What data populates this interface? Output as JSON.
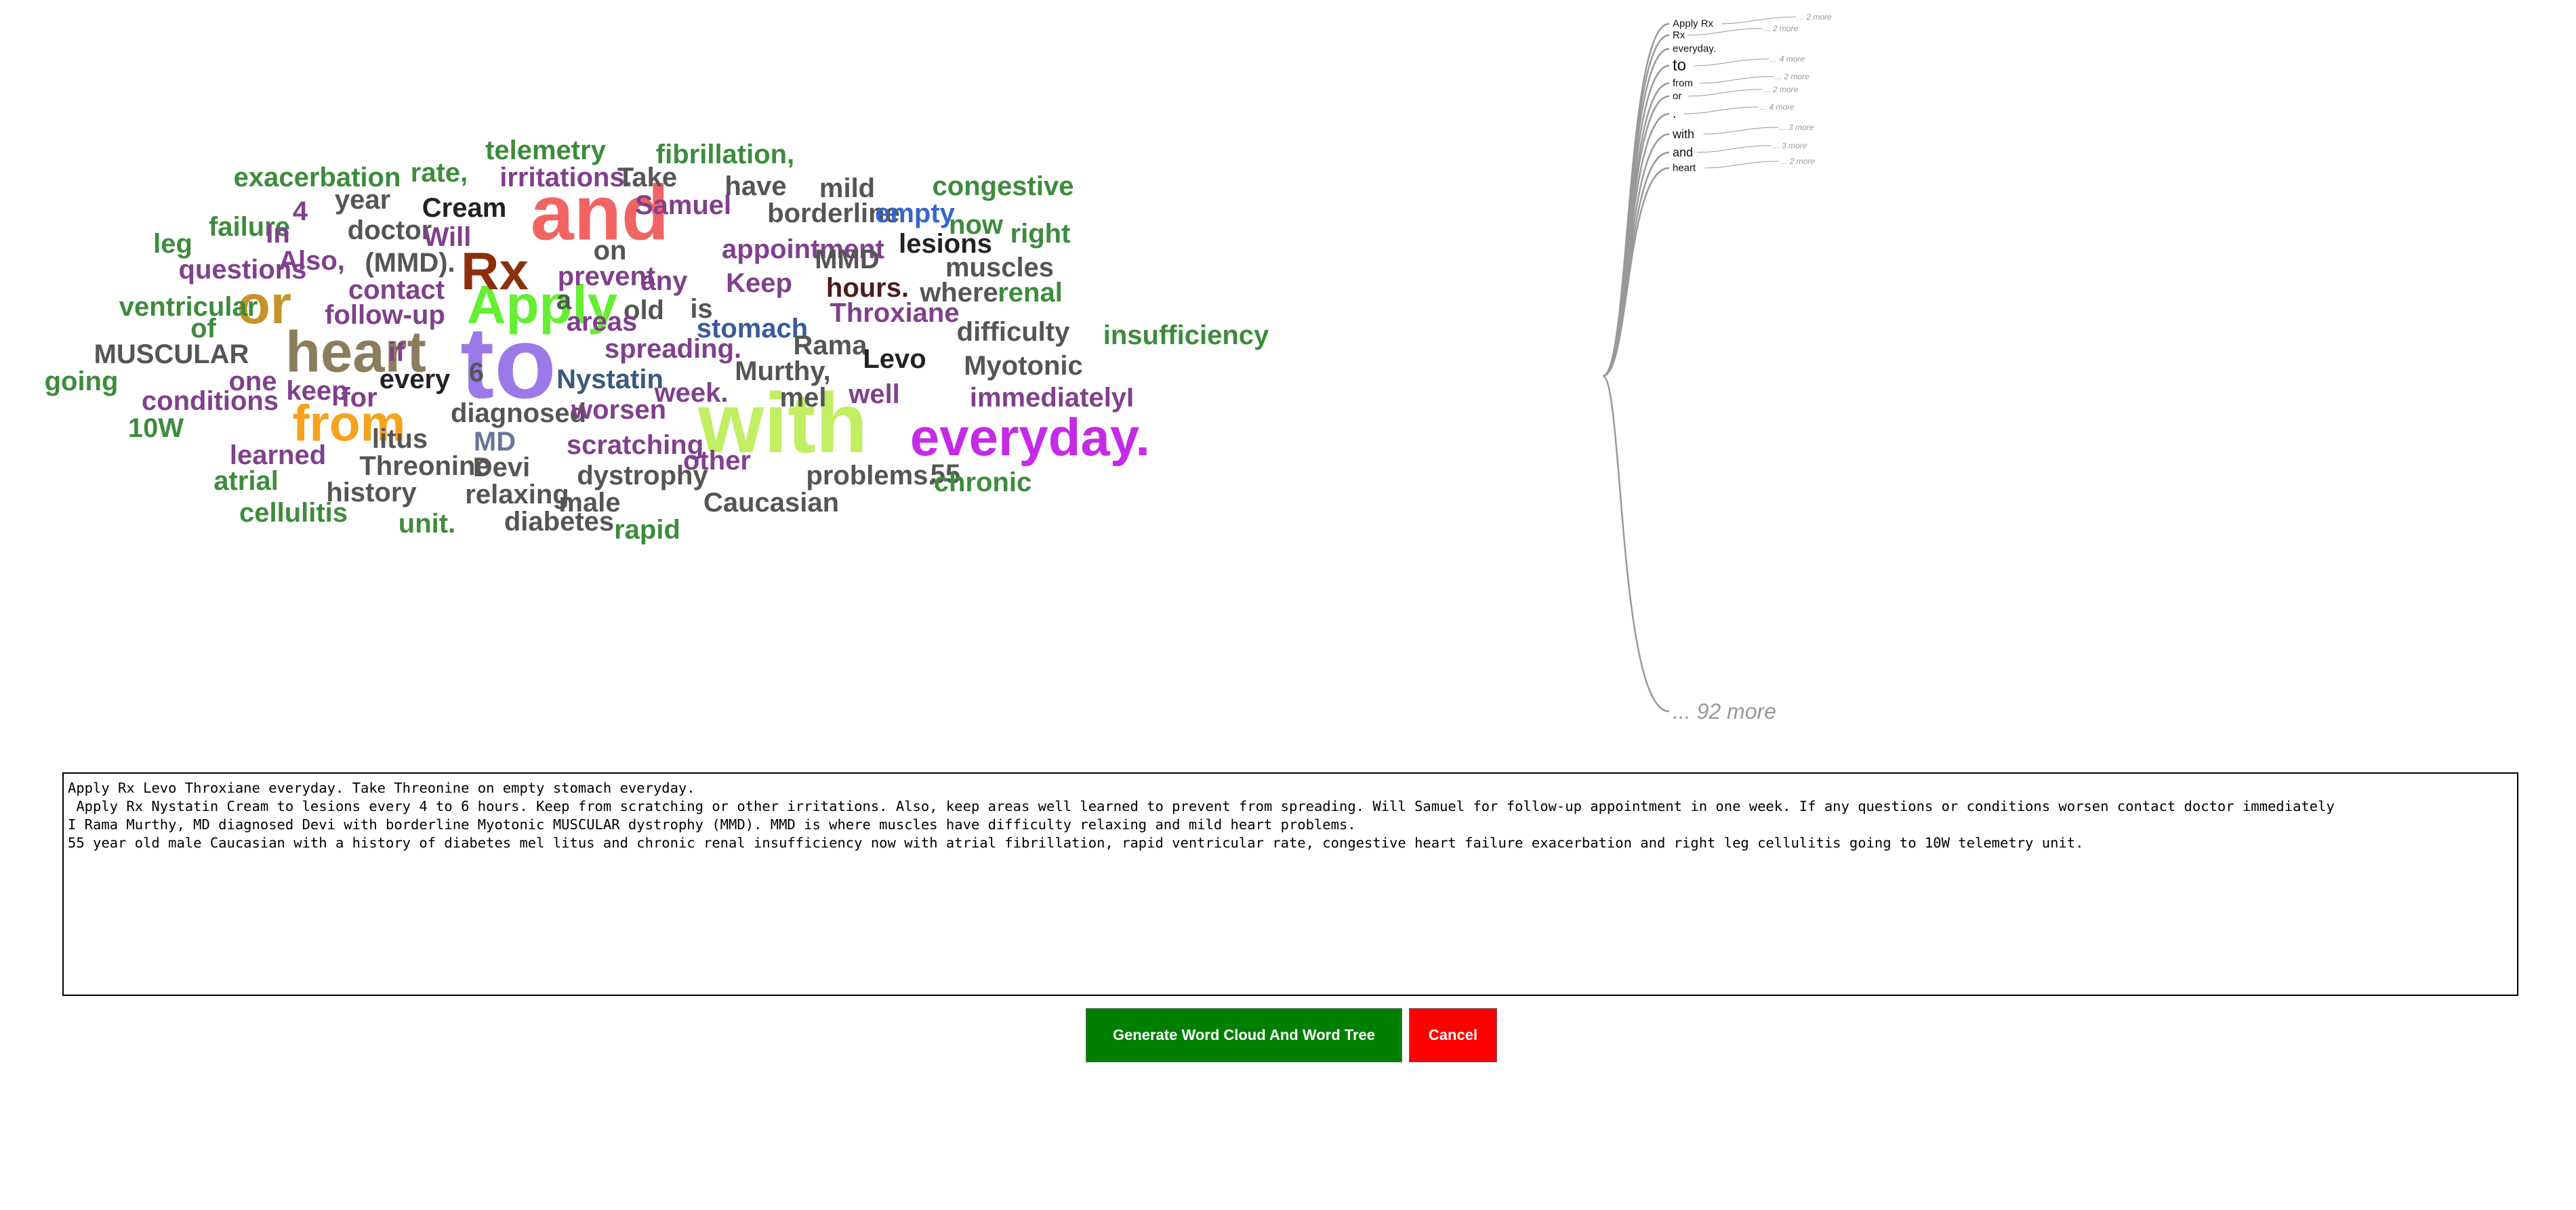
{
  "cloud": {
    "words": [
      {
        "text": "to",
        "color": "#9b79e9",
        "size": 150
      },
      {
        "text": "with",
        "color": "#c2ee63",
        "size": 125
      },
      {
        "text": "and",
        "color": "#f26464",
        "size": 115
      },
      {
        "text": "heart",
        "color": "#8b7d5d",
        "size": 85
      },
      {
        "text": "from",
        "color": "#f5a21d",
        "size": 75
      },
      {
        "text": "everyday.",
        "color": "#c32be6",
        "size": 78
      },
      {
        "text": "Apply",
        "color": "#66ee33",
        "size": 80
      },
      {
        "text": "Rx",
        "color": "#8b2f0c",
        "size": 78
      },
      {
        "text": "or",
        "color": "#c4932a",
        "size": 80
      },
      {
        "text": "telemetry",
        "color": "#3c8c3c",
        "size": 40
      },
      {
        "text": "fibrillation,",
        "color": "#3c8c3c",
        "size": 40
      },
      {
        "text": "exacerbation",
        "color": "#3c8c3c",
        "size": 40
      },
      {
        "text": "rate,",
        "color": "#3c8c3c",
        "size": 40
      },
      {
        "text": "irritations.",
        "color": "#80408c",
        "size": 40
      },
      {
        "text": "Take",
        "color": "#555555",
        "size": 40
      },
      {
        "text": "have",
        "color": "#555555",
        "size": 40
      },
      {
        "text": "mild",
        "color": "#555555",
        "size": 40
      },
      {
        "text": "congestive",
        "color": "#3c8c3c",
        "size": 40
      },
      {
        "text": "4",
        "color": "#80408c",
        "size": 40
      },
      {
        "text": "year",
        "color": "#555555",
        "size": 40
      },
      {
        "text": "Cream",
        "color": "#222222",
        "size": 40
      },
      {
        "text": "Samuel",
        "color": "#80408c",
        "size": 40
      },
      {
        "text": "borderline",
        "color": "#555555",
        "size": 40
      },
      {
        "text": "empty",
        "color": "#3366cc",
        "size": 40
      },
      {
        "text": "now",
        "color": "#3c8c3c",
        "size": 40
      },
      {
        "text": "right",
        "color": "#3c8c3c",
        "size": 40
      },
      {
        "text": "failure",
        "color": "#3c8c3c",
        "size": 40
      },
      {
        "text": "In",
        "color": "#80408c",
        "size": 40
      },
      {
        "text": "doctor",
        "color": "#555555",
        "size": 40
      },
      {
        "text": "Will",
        "color": "#80408c",
        "size": 40
      },
      {
        "text": "leg",
        "color": "#3c8c3c",
        "size": 40
      },
      {
        "text": "on",
        "color": "#555555",
        "size": 40
      },
      {
        "text": "appointment",
        "color": "#80408c",
        "size": 40
      },
      {
        "text": "MMD",
        "color": "#555555",
        "size": 40
      },
      {
        "text": "lesions",
        "color": "#222222",
        "size": 40
      },
      {
        "text": "questions",
        "color": "#80408c",
        "size": 40
      },
      {
        "text": "Also,",
        "color": "#80408c",
        "size": 40
      },
      {
        "text": "(MMD).",
        "color": "#555555",
        "size": 40
      },
      {
        "text": "prevent",
        "color": "#80408c",
        "size": 40
      },
      {
        "text": "muscles",
        "color": "#555555",
        "size": 40
      },
      {
        "text": "Keep",
        "color": "#80408c",
        "size": 40
      },
      {
        "text": "any",
        "color": "#80408c",
        "size": 40
      },
      {
        "text": "hours.",
        "color": "#4c1c1c",
        "size": 40
      },
      {
        "text": "where",
        "color": "#555555",
        "size": 40
      },
      {
        "text": "renal",
        "color": "#3c8c3c",
        "size": 40
      },
      {
        "text": "contact",
        "color": "#80408c",
        "size": 40
      },
      {
        "text": "ventricular",
        "color": "#3c8c3c",
        "size": 40
      },
      {
        "text": "a",
        "color": "#555555",
        "size": 40
      },
      {
        "text": "old",
        "color": "#555555",
        "size": 40
      },
      {
        "text": "is",
        "color": "#555555",
        "size": 40
      },
      {
        "text": "Throxiane",
        "color": "#80408c",
        "size": 40
      },
      {
        "text": "follow-up",
        "color": "#80408c",
        "size": 40
      },
      {
        "text": "areas",
        "color": "#80408c",
        "size": 40
      },
      {
        "text": "stomach",
        "color": "#3a5a9a",
        "size": 40
      },
      {
        "text": "of",
        "color": "#3c8c3c",
        "size": 40
      },
      {
        "text": "difficulty",
        "color": "#555555",
        "size": 40
      },
      {
        "text": "insufficiency",
        "color": "#3c8c3c",
        "size": 40
      },
      {
        "text": "MUSCULAR",
        "color": "#555555",
        "size": 40
      },
      {
        "text": "spreading.",
        "color": "#80408c",
        "size": 40
      },
      {
        "text": "Rama",
        "color": "#555555",
        "size": 40
      },
      {
        "text": "Levo",
        "color": "#222222",
        "size": 40
      },
      {
        "text": "if",
        "color": "#80408c",
        "size": 40
      },
      {
        "text": "Myotonic",
        "color": "#555555",
        "size": 40
      },
      {
        "text": "one",
        "color": "#80408c",
        "size": 40
      },
      {
        "text": "6",
        "color": "#555555",
        "size": 40
      },
      {
        "text": "Murthy,",
        "color": "#555555",
        "size": 40
      },
      {
        "text": "going",
        "color": "#3c8c3c",
        "size": 40
      },
      {
        "text": "every",
        "color": "#222222",
        "size": 40
      },
      {
        "text": "Nystatin",
        "color": "#3a5a7a",
        "size": 40
      },
      {
        "text": "keep",
        "color": "#80408c",
        "size": 40
      },
      {
        "text": "for",
        "color": "#80408c",
        "size": 40
      },
      {
        "text": "week.",
        "color": "#80408c",
        "size": 40
      },
      {
        "text": "mel",
        "color": "#555555",
        "size": 40
      },
      {
        "text": "well",
        "color": "#80408c",
        "size": 40
      },
      {
        "text": "immediatelyI",
        "color": "#80408c",
        "size": 40
      },
      {
        "text": "conditions",
        "color": "#80408c",
        "size": 40
      },
      {
        "text": "diagnosed",
        "color": "#555555",
        "size": 40
      },
      {
        "text": "worsen",
        "color": "#80408c",
        "size": 40
      },
      {
        "text": "10W",
        "color": "#3c8c3c",
        "size": 40
      },
      {
        "text": "litus",
        "color": "#555555",
        "size": 40
      },
      {
        "text": "MD",
        "color": "#667799",
        "size": 40
      },
      {
        "text": "scratching",
        "color": "#80408c",
        "size": 40
      },
      {
        "text": "learned",
        "color": "#80408c",
        "size": 40
      },
      {
        "text": "Threonine",
        "color": "#555555",
        "size": 40
      },
      {
        "text": "Devi",
        "color": "#555555",
        "size": 40
      },
      {
        "text": "other",
        "color": "#80408c",
        "size": 40
      },
      {
        "text": "atrial",
        "color": "#3c8c3c",
        "size": 40
      },
      {
        "text": "dystrophy",
        "color": "#555555",
        "size": 40
      },
      {
        "text": "problems.",
        "color": "#555555",
        "size": 40
      },
      {
        "text": "55",
        "color": "#555555",
        "size": 40
      },
      {
        "text": "chronic",
        "color": "#3c8c3c",
        "size": 40
      },
      {
        "text": "history",
        "color": "#555555",
        "size": 40
      },
      {
        "text": "relaxing",
        "color": "#555555",
        "size": 40
      },
      {
        "text": "male",
        "color": "#555555",
        "size": 40
      },
      {
        "text": "Caucasian",
        "color": "#555555",
        "size": 40
      },
      {
        "text": "cellulitis",
        "color": "#3c8c3c",
        "size": 40
      },
      {
        "text": "unit.",
        "color": "#3c8c3c",
        "size": 40
      },
      {
        "text": "diabetes",
        "color": "#555555",
        "size": 40
      },
      {
        "text": "rapid",
        "color": "#3c8c3c",
        "size": 40
      }
    ]
  },
  "tree": {
    "branches": [
      {
        "word": "Apply Rx",
        "more": "... 2 more"
      },
      {
        "word": "Rx",
        "more": "... 2 more"
      },
      {
        "word": "everyday.",
        "more": ""
      },
      {
        "word": "to",
        "more": "... 4 more"
      },
      {
        "word": "from",
        "more": "... 2 more"
      },
      {
        "word": "or",
        "more": "... 2 more"
      },
      {
        "word": ".",
        "more": "... 4 more"
      },
      {
        "word": "with",
        "more": "... 3 more"
      },
      {
        "word": "and",
        "more": "... 3 more"
      },
      {
        "word": "heart",
        "more": "... 2 more"
      }
    ],
    "remaining": "... 92 more"
  },
  "notes": {
    "text": "Apply Rx Levo Throxiane everyday. Take Threonine on empty stomach everyday.\n Apply Rx Nystatin Cream to lesions every 4 to 6 hours. Keep from scratching or other irritations. Also, keep areas well learned to prevent from spreading. Will Samuel for follow-up appointment in one week. If any questions or conditions worsen contact doctor immediately\nI Rama Murthy, MD diagnosed Devi with borderline Myotonic MUSCULAR dystrophy (MMD). MMD is where muscles have difficulty relaxing and mild heart problems.\n55 year old male Caucasian with a history of diabetes mel litus and chronic renal insufficiency now with atrial fibrillation, rapid ventricular rate, congestive heart failure exacerbation and right leg cellulitis going to 10W telemetry unit."
  },
  "buttons": {
    "generate": "Generate Word Cloud And Word Tree",
    "cancel": "Cancel"
  }
}
